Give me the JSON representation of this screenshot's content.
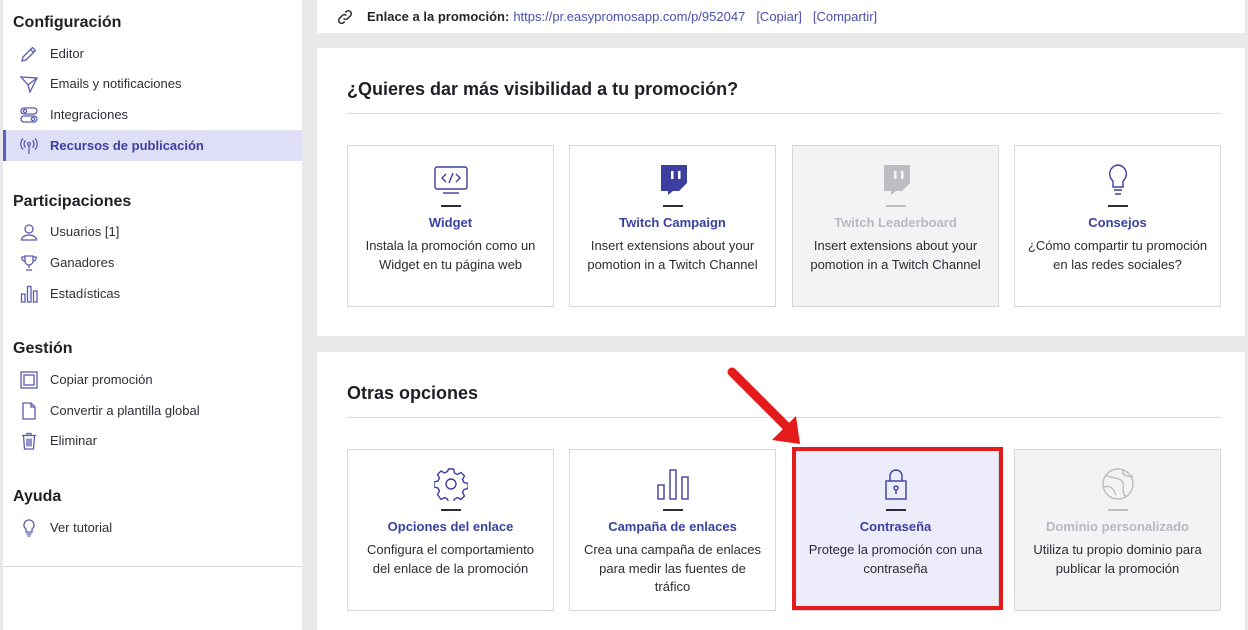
{
  "sidebar": {
    "sections": [
      {
        "title": "Configuración",
        "items": [
          {
            "label": "Editor",
            "icon": "pencil-icon"
          },
          {
            "label": "Emails y notificaciones",
            "icon": "send-icon"
          },
          {
            "label": "Integraciones",
            "icon": "toggles-icon"
          },
          {
            "label": "Recursos de publicación",
            "icon": "broadcast-icon",
            "active": true
          }
        ]
      },
      {
        "title": "Participaciones",
        "items": [
          {
            "label": "Usuarios [1]",
            "icon": "user-icon"
          },
          {
            "label": "Ganadores",
            "icon": "trophy-icon"
          },
          {
            "label": "Estadísticas",
            "icon": "bar-chart-icon"
          }
        ]
      },
      {
        "title": "Gestión",
        "items": [
          {
            "label": "Copiar promoción",
            "icon": "copy-icon"
          },
          {
            "label": "Convertir a plantilla global",
            "icon": "document-icon"
          },
          {
            "label": "Eliminar",
            "icon": "trash-icon"
          }
        ]
      },
      {
        "title": "Ayuda",
        "items": [
          {
            "label": "Ver tutorial",
            "icon": "lightbulb-icon"
          }
        ]
      }
    ]
  },
  "topbar": {
    "label": "Enlace a la promoción:",
    "url": "https://pr.easypromosapp.com/p/952047",
    "copy": "[Copiar]",
    "share": "[Compartir]"
  },
  "visibility": {
    "title": "¿Quieres dar más visibilidad a tu promoción?",
    "cards": [
      {
        "title": "Widget",
        "desc": "Instala la promoción como un Widget en tu página web",
        "icon": "code-window-icon"
      },
      {
        "title": "Twitch Campaign",
        "desc": "Insert extensions about your pomotion in a Twitch Channel",
        "icon": "twitch-icon"
      },
      {
        "title": "Twitch Leaderboard",
        "desc": "Insert extensions about your pomotion in a Twitch Channel",
        "icon": "twitch-icon",
        "disabled": true
      },
      {
        "title": "Consejos",
        "desc": "¿Cómo compartir tu promoción en las redes sociales?",
        "icon": "lightbulb-icon"
      }
    ]
  },
  "other": {
    "title": "Otras opciones",
    "cards": [
      {
        "title": "Opciones del enlace",
        "desc": "Configura el comportamiento del enlace de la promoción",
        "icon": "gear-icon"
      },
      {
        "title": "Campaña de enlaces",
        "desc": "Crea una campaña de enlaces para medir las fuentes de tráfico",
        "icon": "bar-chart-icon"
      },
      {
        "title": "Contraseña",
        "desc": "Protege la promoción con una contraseña",
        "icon": "lock-icon",
        "highlight": true
      },
      {
        "title": "Dominio personalizado",
        "desc": "Utiliza tu propio dominio para publicar la promoción",
        "icon": "globe-icon",
        "disabled": true
      }
    ]
  },
  "colors": {
    "accent": "#3d3fa0",
    "active_bg": "#dedff6",
    "annotation": "#e31b1b"
  }
}
